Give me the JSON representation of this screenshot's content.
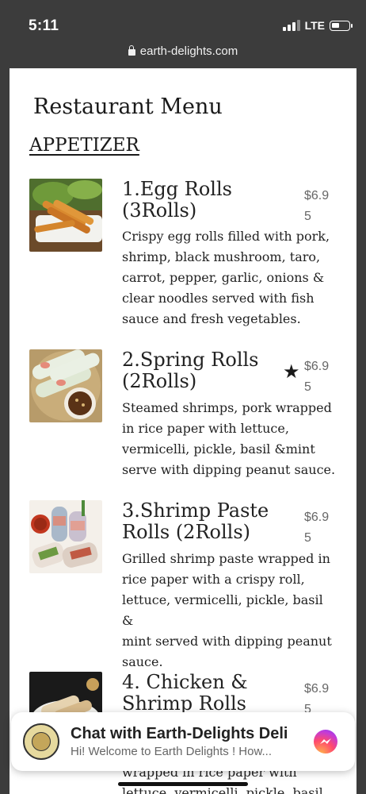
{
  "status_bar": {
    "time": "5:11",
    "network": "LTE"
  },
  "browser": {
    "url": "earth-delights.com"
  },
  "page": {
    "title": "Restaurant Menu",
    "section": "APPETIZER",
    "items": [
      {
        "name": "1.Egg Rolls (3Rolls)",
        "price": "$6.95",
        "description_lines": [
          "Crispy egg rolls filled with pork,",
          "shrimp, black mushroom, taro,",
          "carrot, pepper, garlic, onions &",
          "clear noodles served with fish",
          "sauce and fresh vegetables."
        ]
      },
      {
        "name": "2.Spring Rolls (2Rolls)",
        "price": "$6.95",
        "starred": true,
        "description_lines": [
          "Steamed shrimps, pork wrapped",
          "in rice paper with lettuce,",
          "vermicelli, pickle, basil &mint",
          "serve with dipping peanut sauce."
        ]
      },
      {
        "name": "3.Shrimp Paste Rolls (2Rolls)",
        "price": "$6.95",
        "description_lines": [
          "Grilled shrimp paste wrapped in",
          "rice paper with a crispy roll,",
          "lettuce, vermicelli, pickle, basil &",
          "mint served with dipping peanut",
          "sauce."
        ]
      },
      {
        "name": "4. Chicken & Shrimp Rolls",
        "price": "$6.95",
        "description_lines": [
          "wrapped in rice paper with",
          "lettuce, vermicelli, pickle, basil &"
        ]
      }
    ]
  },
  "chat": {
    "title": "Chat with Earth-Delights Deli",
    "preview": "Hi! Welcome to Earth Delights ! How..."
  },
  "icons": {
    "lock": "lock-icon",
    "star": "star-icon",
    "messenger": "messenger-icon"
  }
}
